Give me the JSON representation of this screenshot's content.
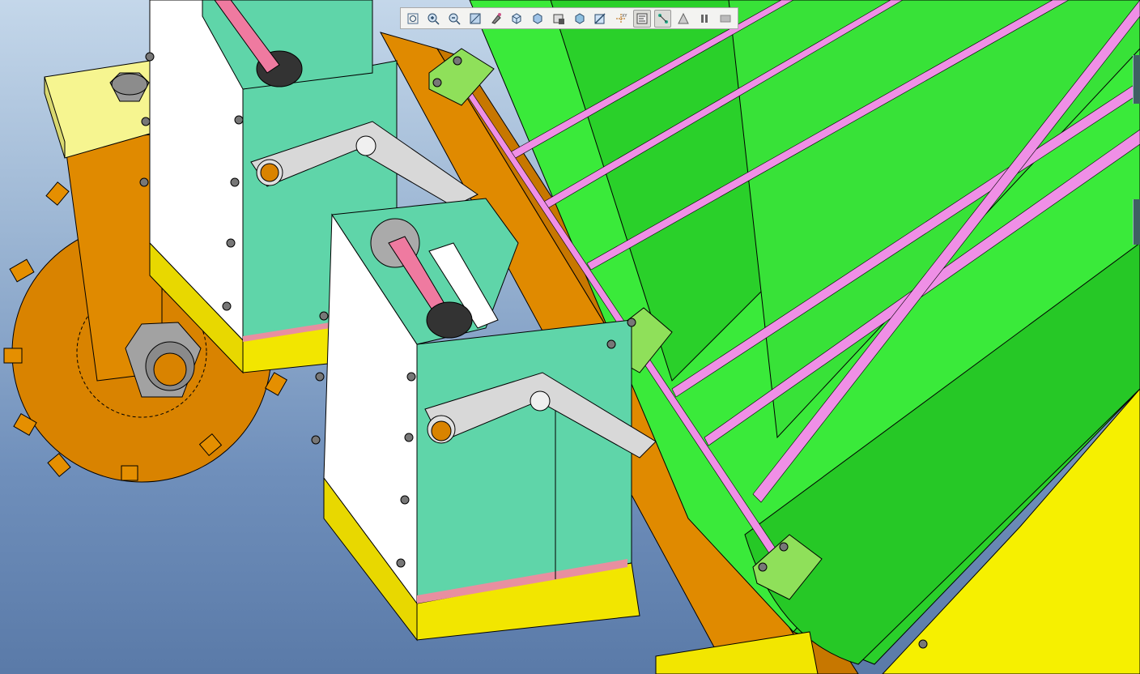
{
  "viewport": {
    "name": "3D model view",
    "background_top": "#c4d7ea",
    "background_bottom": "#5a7aa8"
  },
  "toolbar": {
    "tools": [
      {
        "name": "zoom-fit-icon",
        "active": false
      },
      {
        "name": "zoom-in-icon",
        "active": false
      },
      {
        "name": "zoom-out-icon",
        "active": false
      },
      {
        "name": "zoom-window-icon",
        "active": false
      },
      {
        "name": "repaint-icon",
        "active": false
      },
      {
        "name": "view-orientation-icon",
        "active": false
      },
      {
        "name": "display-style-icon",
        "active": false
      },
      {
        "name": "saved-views-icon",
        "active": false
      },
      {
        "name": "appearance-icon",
        "active": false
      },
      {
        "name": "cross-section-icon",
        "active": false
      },
      {
        "name": "datum-display-icon",
        "active": false
      },
      {
        "name": "model-tree-icon",
        "active": true
      },
      {
        "name": "connection-icon",
        "active": true
      },
      {
        "name": "analysis-icon",
        "active": false
      },
      {
        "name": "pause-icon",
        "active": false
      },
      {
        "name": "command-icon",
        "active": false
      }
    ]
  },
  "colors": {
    "green_panel": "#3aea3a",
    "green_dark": "#26c826",
    "mint_plate": "#5fd5a9",
    "orange_frame": "#d98300",
    "yellow_base": "#f2e600",
    "pink_rod": "#ef8fe6",
    "light_green_block": "#8fe05a"
  }
}
